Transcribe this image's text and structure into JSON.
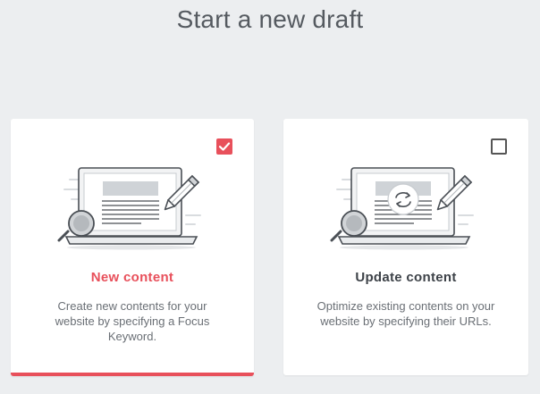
{
  "header": {
    "title": "Start a new draft"
  },
  "colors": {
    "accent": "#e8505b",
    "title_dark": "#3d4248",
    "background": "#eceef0"
  },
  "cards": [
    {
      "title": "New content",
      "description": "Create new contents for your website by specifying a Focus Keyword.",
      "checked": true,
      "icon": "laptop-document-magnifier-pencil-icon"
    },
    {
      "title": "Update content",
      "description": "Optimize existing contents on your website by specifying their URLs.",
      "checked": false,
      "icon": "laptop-document-refresh-pencil-icon"
    }
  ]
}
